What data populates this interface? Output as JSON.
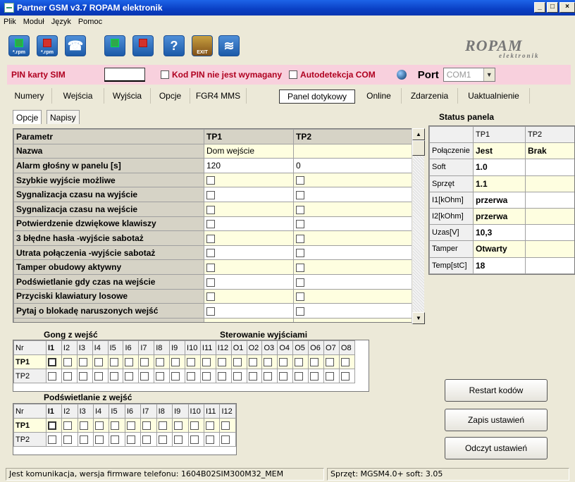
{
  "window": {
    "title": "Partner GSM v3.7 ROPAM elektronik"
  },
  "menu": [
    "Plik",
    "Moduł",
    "Język",
    "Pomoc"
  ],
  "toolbar": {
    "buttons": [
      {
        "icon": "upload-rpm-icon",
        "label": "*.rpm"
      },
      {
        "icon": "download-rpm-icon",
        "label": "*.rpm"
      },
      {
        "icon": "modem-icon",
        "label": ""
      },
      {
        "icon": "upload-icon",
        "label": ""
      },
      {
        "icon": "download-icon",
        "label": ""
      },
      {
        "icon": "help-icon",
        "label": "?"
      },
      {
        "icon": "exit-icon",
        "label": "EXIT"
      },
      {
        "icon": "wireless-icon",
        "label": ""
      }
    ]
  },
  "logo": {
    "text": "ROPAM",
    "sub": "elektronik"
  },
  "pin": {
    "label": "PIN karty SIM",
    "value": "",
    "no_pin_label": "Kod PIN nie jest wymagany",
    "autodetect_label": "Autodetekcja COM",
    "port_label": "Port",
    "port_value": "COM1"
  },
  "tabs": [
    "Numery",
    "Wejścia",
    "Wyjścia",
    "Opcje",
    "FGR4 MMS",
    "Panel dotykowy",
    "Online",
    "Zdarzenia",
    "Uaktualnienie"
  ],
  "active_tab": "Panel dotykowy",
  "subtabs": [
    "Opcje",
    "Napisy"
  ],
  "params": {
    "headers": [
      "Parametr",
      "TP1",
      "TP2"
    ],
    "rows": [
      {
        "name": "Nazwa",
        "tp1": "Dom wejście",
        "tp2": ""
      },
      {
        "name": "Alarm głośny w panelu [s]",
        "tp1": "120",
        "tp2": "0"
      },
      {
        "name": "Szybkie wyjście możliwe",
        "tp1": "",
        "tp2": ""
      },
      {
        "name": "Sygnalizacja czasu na wyjście",
        "tp1": "",
        "tp2": ""
      },
      {
        "name": "Sygnalizacja czasu na wejście",
        "tp1": "",
        "tp2": ""
      },
      {
        "name": "Potwierdzenie dzwiękowe klawiszy",
        "tp1": "",
        "tp2": ""
      },
      {
        "name": "3 błędne hasła -wyjście sabotaż",
        "tp1": "",
        "tp2": ""
      },
      {
        "name": "Utrata połączenia -wyjście sabotaż",
        "tp1": "",
        "tp2": ""
      },
      {
        "name": "Tamper obudowy aktywny",
        "tp1": "",
        "tp2": ""
      },
      {
        "name": "Podświetlanie gdy czas na wejście",
        "tp1": "",
        "tp2": ""
      },
      {
        "name": "Przyciski klawiatury losowe",
        "tp1": "",
        "tp2": ""
      },
      {
        "name": "Pytaj o blokadę naruszonych wejść",
        "tp1": "",
        "tp2": ""
      },
      {
        "name": "",
        "tp1": "",
        "tp2": ""
      }
    ]
  },
  "gong": {
    "title": "Gong z wejść",
    "outputs_title": "Sterowanie wyjściami",
    "cols": [
      "Nr",
      "I1",
      "I2",
      "I3",
      "I4",
      "I5",
      "I6",
      "I7",
      "I8",
      "I9",
      "I10",
      "I11",
      "I12",
      "O1",
      "O2",
      "O3",
      "O4",
      "O5",
      "O6",
      "O7",
      "O8"
    ],
    "rows": [
      "TP1",
      "TP2"
    ]
  },
  "backlight": {
    "title": "Podświetlanie z wejść",
    "cols": [
      "Nr",
      "I1",
      "I2",
      "I3",
      "I4",
      "I5",
      "I6",
      "I7",
      "I8",
      "I9",
      "I10",
      "I11",
      "I12"
    ],
    "rows": [
      "TP1",
      "TP2"
    ]
  },
  "status": {
    "title": "Status panela",
    "headers": [
      "",
      "TP1",
      "TP2"
    ],
    "rows": [
      {
        "label": "Połączenie",
        "tp1": "Jest",
        "tp2": "Brak"
      },
      {
        "label": "Soft",
        "tp1": "1.0",
        "tp2": ""
      },
      {
        "label": "Sprzęt",
        "tp1": "1.1",
        "tp2": ""
      },
      {
        "label": "I1[kOhm]",
        "tp1": "przerwa",
        "tp2": ""
      },
      {
        "label": "I2[kOhm]",
        "tp1": "przerwa",
        "tp2": ""
      },
      {
        "label": "Uzas[V]",
        "tp1": "10,3",
        "tp2": ""
      },
      {
        "label": "Tamper",
        "tp1": "Otwarty",
        "tp2": ""
      },
      {
        "label": "Temp[stC]",
        "tp1": "18",
        "tp2": ""
      }
    ]
  },
  "buttons": {
    "restart": "Restart kodów",
    "save": "Zapis ustawień",
    "read": "Odczyt ustawień"
  },
  "statusbar": {
    "left": "Jest komunikacja, wersja firmware telefonu: 1604B02SIM300M32_MEM",
    "right": "Sprzęt: MGSM4.0+ soft: 3.05"
  },
  "colors": {
    "title_bar": "#0a3fc4",
    "pin_bar": "#f8d0dd",
    "pin_text": "#b00020",
    "grid_alt": "#fefee0"
  }
}
